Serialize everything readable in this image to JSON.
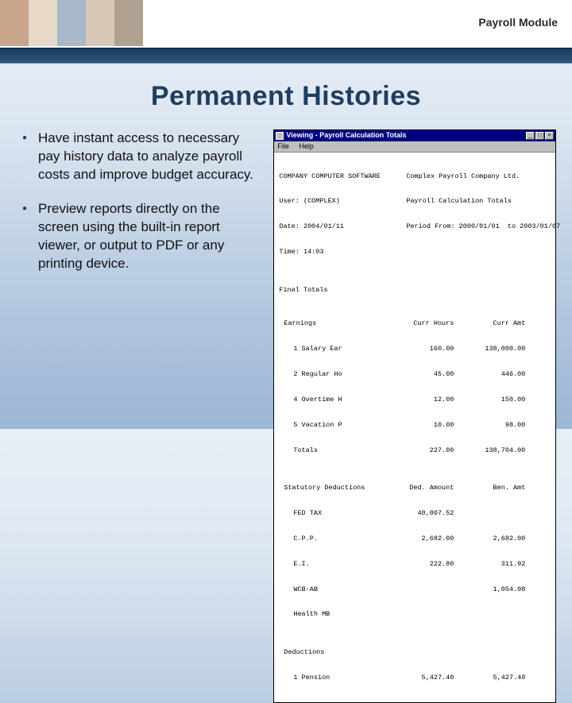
{
  "header": {
    "module_label": "Payroll Module"
  },
  "title": "Permanent Histories",
  "bullets": [
    "Have instant access to necessary pay history data to analyze payroll costs and improve budget accuracy.",
    "Preview reports directly on the screen using the built-in report viewer, or output to PDF or any printing device."
  ],
  "report_window": {
    "title": "Viewing - Payroll Calculation Totals",
    "menu": [
      "File",
      "Help"
    ],
    "company_code": "COMPANY COMPUTER SOFTWARE",
    "user": "User: (COMPLEX)",
    "date": "Date: 2004/01/11",
    "time": "Time: 14:03",
    "company_name": "Complex Payroll Company Ltd.",
    "report_name": "Payroll Calculation Totals",
    "period": "Period From: 2000/01/01  to 2003/01/07",
    "final_totals_label": "Final Totals",
    "earnings_header": "Earnings",
    "col_h1": "Curr Hours",
    "col_h2": "Curr Amt",
    "earnings": [
      {
        "label": "1 Salary Ear",
        "hours": "160.00",
        "amt": "138,000.00"
      },
      {
        "label": "2 Regular Ho",
        "hours": "45.00",
        "amt": "446.00"
      },
      {
        "label": "4 Overtime H",
        "hours": "12.00",
        "amt": "150.00"
      },
      {
        "label": "5 Vacation P",
        "hours": "10.00",
        "amt": "98.00"
      },
      {
        "label": "Totals",
        "hours": "227.00",
        "amt": "138,704.00"
      }
    ],
    "statutory_header": "Statutory Deductions",
    "stat_col1": "Ded. Amount",
    "stat_col2": "Ben. Amt",
    "statutory": [
      {
        "label": "FED TAX",
        "d": "40,007.52",
        "b": ""
      },
      {
        "label": "C.P.P.",
        "d": "2,682.00",
        "b": "2,682.00"
      },
      {
        "label": "E.I.",
        "d": "222.80",
        "b": "311.92"
      },
      {
        "label": "WCB-AB",
        "d": "",
        "b": "1,054.08"
      },
      {
        "label": "Health MB",
        "d": "",
        "b": ""
      }
    ],
    "deductions_header": "Deductions",
    "deductions": [
      {
        "label": "1 Pension",
        "d": "5,427.40",
        "b": "5,427.40"
      }
    ]
  }
}
